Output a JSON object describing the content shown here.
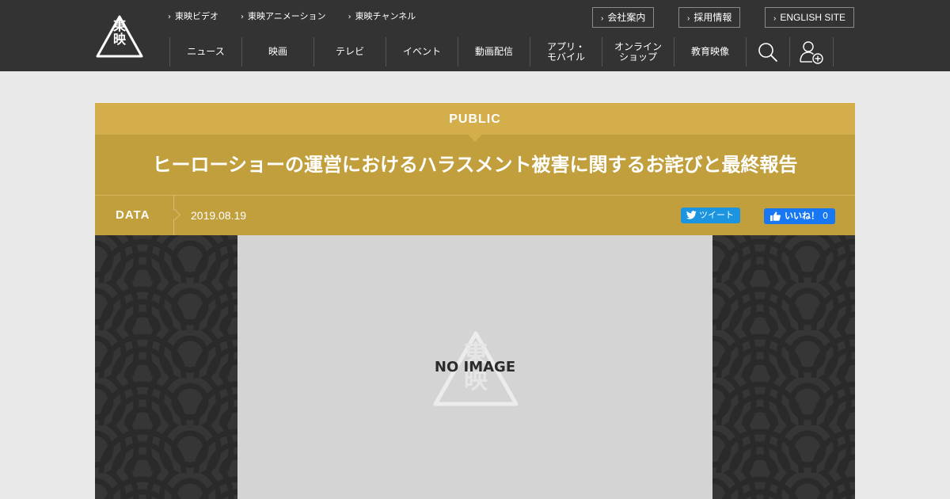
{
  "brand": {
    "logo_text_line1": "東",
    "logo_text_line2": "映"
  },
  "header": {
    "sublinks": [
      {
        "label": "東映ビデオ"
      },
      {
        "label": "東映アニメーション"
      },
      {
        "label": "東映チャンネル"
      }
    ],
    "corp_buttons": [
      {
        "label": "会社案内"
      },
      {
        "label": "採用情報"
      },
      {
        "label": "ENGLISH SITE"
      }
    ],
    "nav": [
      {
        "label": "ニュース"
      },
      {
        "label": "映画"
      },
      {
        "label": "テレビ"
      },
      {
        "label": "イベント"
      },
      {
        "label": "動画配信"
      },
      {
        "label": "アプリ・\nモバイル"
      },
      {
        "label": "オンライン\nショップ"
      },
      {
        "label": "教育映像"
      }
    ],
    "icons": [
      "search-icon",
      "user-add-icon"
    ]
  },
  "article": {
    "category": "PUBLIC",
    "title": "ヒーローショーの運営におけるハラスメント被害に関するお詫びと最終報告",
    "data_label": "DATA",
    "date": "2019.08.19",
    "tweet_label": "ツイート",
    "like_label": "いいね！",
    "like_count": "0",
    "no_image_text": "NO IMAGE"
  },
  "colors": {
    "header_bg": "#333333",
    "category_bar": "#d3ae4b",
    "title_bar": "#c19f3d",
    "twitter": "#1b95e0",
    "facebook": "#1877f2",
    "page_bg": "#e9e9e9"
  }
}
